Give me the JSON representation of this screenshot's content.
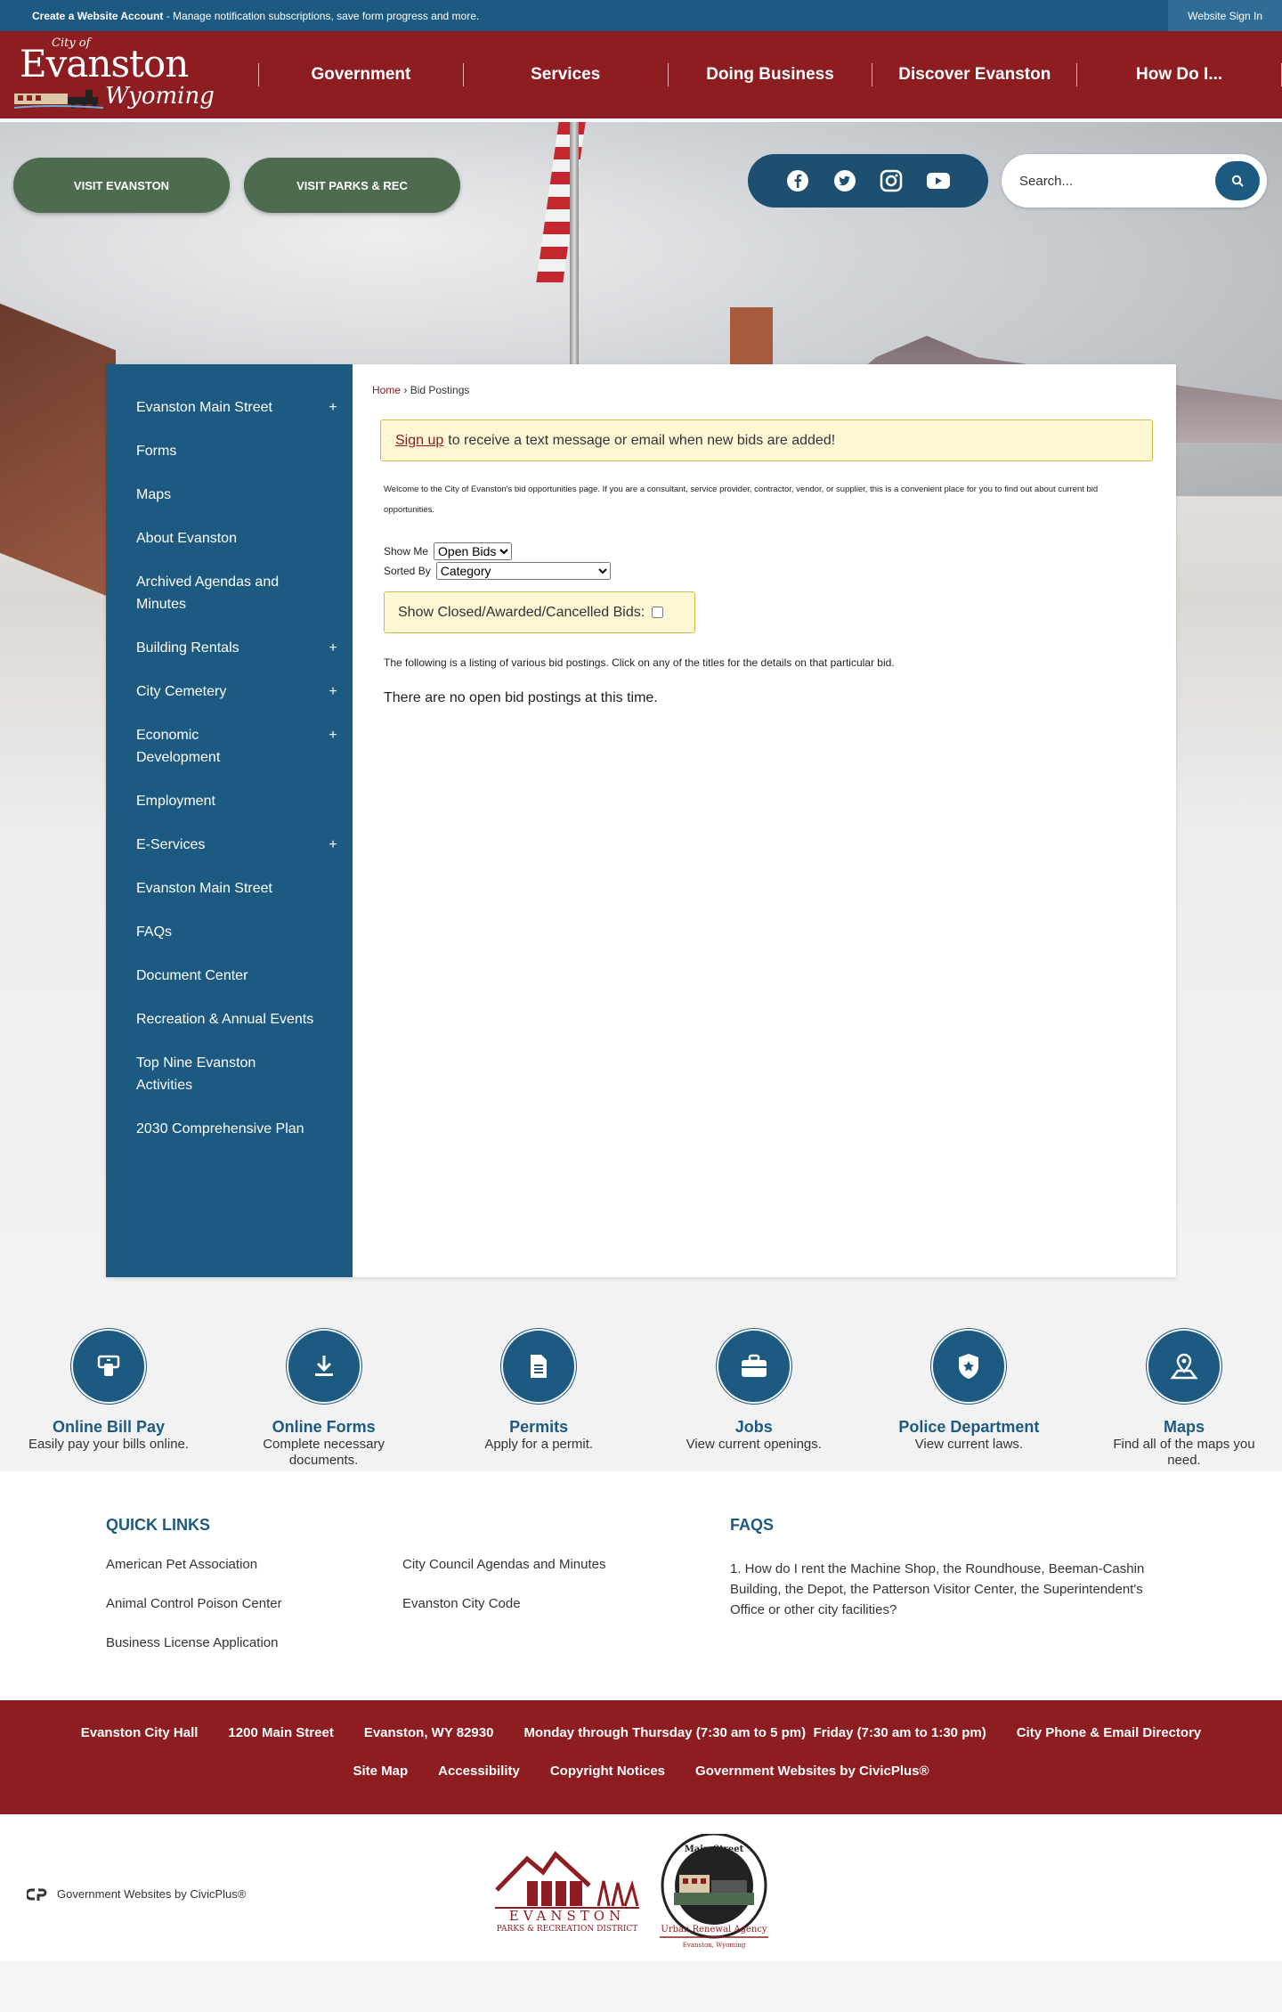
{
  "topbar": {
    "create_bold": "Create a Website Account",
    "create_rest": " - Manage notification subscriptions, save form progress and more.",
    "signin": "Website Sign In"
  },
  "logo": {
    "cityof": "City of",
    "name": "Evanston",
    "state": "Wyoming"
  },
  "nav": [
    "Government",
    "Services",
    "Doing Business",
    "Discover Evanston",
    "How Do I..."
  ],
  "hero": {
    "buttons": [
      "VISIT EVANSTON",
      "VISIT PARKS & REC"
    ],
    "social": [
      "facebook-icon",
      "twitter-icon",
      "instagram-icon",
      "youtube-icon"
    ],
    "search_placeholder": "Search..."
  },
  "sidenav": [
    {
      "label": "Evanston Main Street",
      "plus": "+"
    },
    {
      "label": "Forms",
      "plus": ""
    },
    {
      "label": "Maps",
      "plus": ""
    },
    {
      "label": "About Evanston",
      "plus": ""
    },
    {
      "label": "Archived Agendas and Minutes",
      "plus": ""
    },
    {
      "label": "Building Rentals",
      "plus": "+"
    },
    {
      "label": "City Cemetery",
      "plus": "+"
    },
    {
      "label": "Economic Development",
      "plus": "+"
    },
    {
      "label": "Employment",
      "plus": ""
    },
    {
      "label": "E-Services",
      "plus": "+"
    },
    {
      "label": "Evanston Main Street",
      "plus": ""
    },
    {
      "label": "FAQs",
      "plus": ""
    },
    {
      "label": "Document Center",
      "plus": ""
    },
    {
      "label": "Recreation & Annual Events",
      "plus": ""
    },
    {
      "label": "Top Nine Evanston Activities",
      "plus": ""
    },
    {
      "label": "2030 Comprehensive Plan",
      "plus": ""
    }
  ],
  "content": {
    "breadcrumb_home": "Home",
    "breadcrumb_sep": " › ",
    "breadcrumb_current": "Bid Postings",
    "signup_link": "Sign up",
    "signup_rest": "to receive a text message or email when new bids are added!",
    "intro": "Welcome to the City of Evanston's bid opportunities page. If you are a consultant, service provider, contractor, vendor, or supplier, this is a convenient place for you to find out about current bid opportunities.",
    "show_me_label": "Show Me",
    "show_me_value": "Open Bids",
    "sorted_by_label": "Sorted By",
    "sorted_by_value": "Category",
    "closed_label": "Show Closed/Awarded/Cancelled Bids:",
    "listing_text": "The following is a listing of various bid postings. Click on any of the titles for the details on that particular bid.",
    "no_bids": "There are no open bid postings at this time."
  },
  "quick": [
    {
      "icon": "bill-pay-icon",
      "title": "Online Bill Pay",
      "desc": "Easily pay your bills online."
    },
    {
      "icon": "download-icon",
      "title": "Online Forms",
      "desc": "Complete necessary documents."
    },
    {
      "icon": "document-icon",
      "title": "Permits",
      "desc": "Apply for a permit."
    },
    {
      "icon": "briefcase-icon",
      "title": "Jobs",
      "desc": "View current openings."
    },
    {
      "icon": "badge-icon",
      "title": "Police Department",
      "desc": "View current laws."
    },
    {
      "icon": "map-pin-icon",
      "title": "Maps",
      "desc": "Find all of the maps you need."
    }
  ],
  "quick_links": {
    "heading": "QUICK LINKS",
    "col1": [
      "American Pet Association",
      "Animal Control Poison Center",
      "Business License Application"
    ],
    "col2": [
      "City Council Agendas and Minutes",
      "Evanston City Code"
    ]
  },
  "faqs": {
    "heading": "FAQS",
    "items": [
      "1. How do I rent the Machine Shop, the Roundhouse, Beeman-Cashin Building, the Depot, the Patterson Visitor Center, the Superintendent's Office or other city facilities?"
    ]
  },
  "footer": {
    "row1": [
      "Evanston City Hall",
      "1200 Main Street",
      "Evanston, WY 82930",
      "Monday through Thursday (7:30 am to 5 pm)  Friday (7:30 am to 1:30 pm)",
      "City Phone & Email Directory"
    ],
    "row2": [
      "Site Map",
      "Accessibility",
      "Copyright Notices",
      "Government Websites by CivicPlus®"
    ]
  },
  "bottom": {
    "civicplus": "Government Websites by CivicPlus®",
    "parks_logo_text": "EVANSTON",
    "parks_logo_sub": "PARKS & RECREATION DISTRICT",
    "ura_top": "Main Street",
    "ura_bottom": "Urban Renewal Agency",
    "ura_city": "Evanston, Wyoming"
  },
  "colors": {
    "brand_red": "#8e1d22",
    "brand_blue": "#1d5a82",
    "green": "#4e6b4f"
  }
}
